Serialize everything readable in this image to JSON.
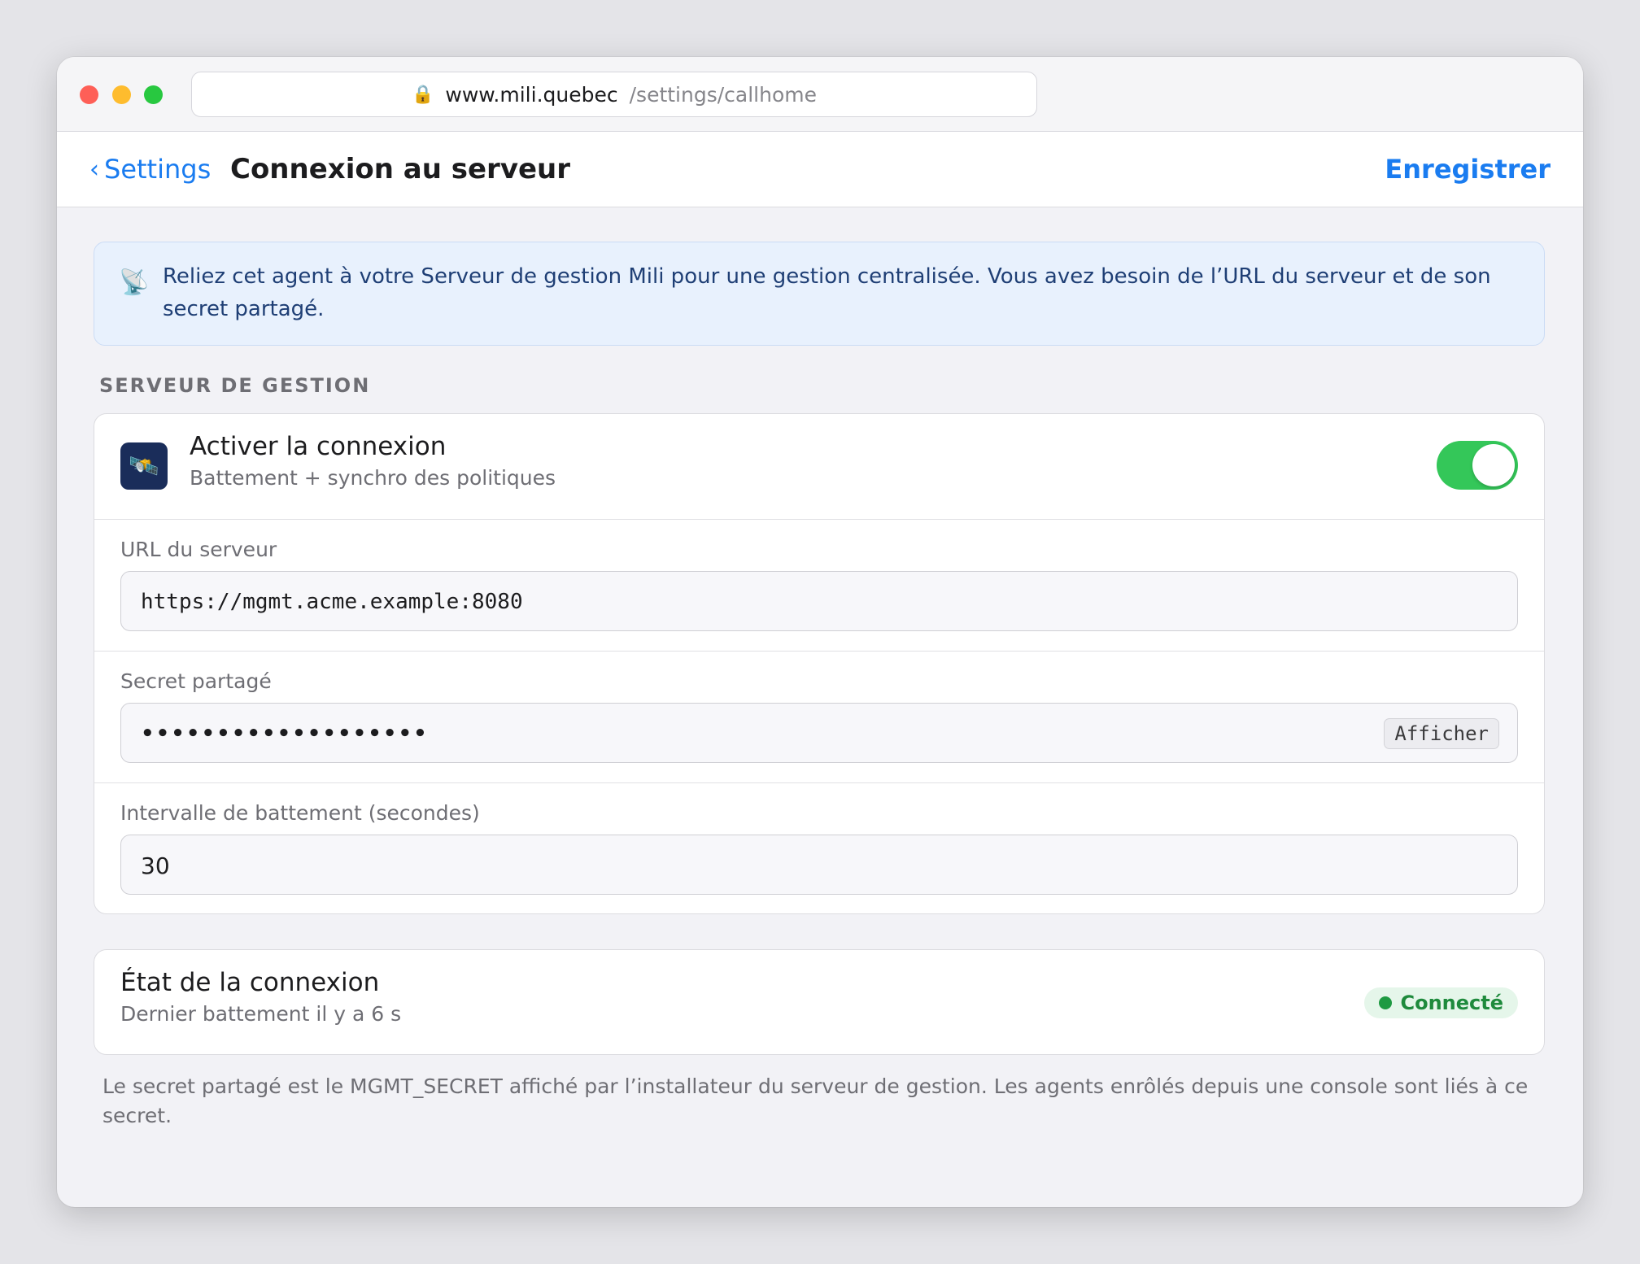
{
  "browser": {
    "host": "www.mili.quebec",
    "path": "/settings/callhome",
    "lock_icon": "lock-icon"
  },
  "navbar": {
    "back_label": "Settings",
    "title": "Connexion au serveur",
    "save_label": "Enregistrer"
  },
  "banner": {
    "icon": "satellite-dish-icon",
    "text": "Reliez cet agent à votre Serveur de gestion Mili pour une gestion centralisée. Vous avez besoin de l’URL du serveur et de son secret partagé."
  },
  "section": {
    "label": "SERVEUR DE GESTION"
  },
  "enable": {
    "icon": "satellite-icon",
    "title": "Activer la connexion",
    "subtitle": "Battement + synchro des politiques",
    "enabled": true
  },
  "server_url": {
    "label": "URL du serveur",
    "value": "https://mgmt.acme.example:8080"
  },
  "secret": {
    "label": "Secret partagé",
    "masked_value": "•••••••••••••••••••",
    "show_label": "Afficher"
  },
  "interval": {
    "label": "Intervalle de battement (secondes)",
    "value": "30"
  },
  "status": {
    "title": "État de la connexion",
    "subtitle": "Dernier battement il y a 6 s",
    "badge": "Connecté"
  },
  "footer": {
    "text": "Le secret partagé est le MGMT_SECRET affiché par l’installateur du serveur de gestion. Les agents enrôlés depuis une console sont liés à ce secret."
  },
  "colors": {
    "accent": "#1a7cf0",
    "toggle_on": "#34c759",
    "status_ok": "#1e8a3c",
    "banner_bg": "#e8f1fd"
  }
}
